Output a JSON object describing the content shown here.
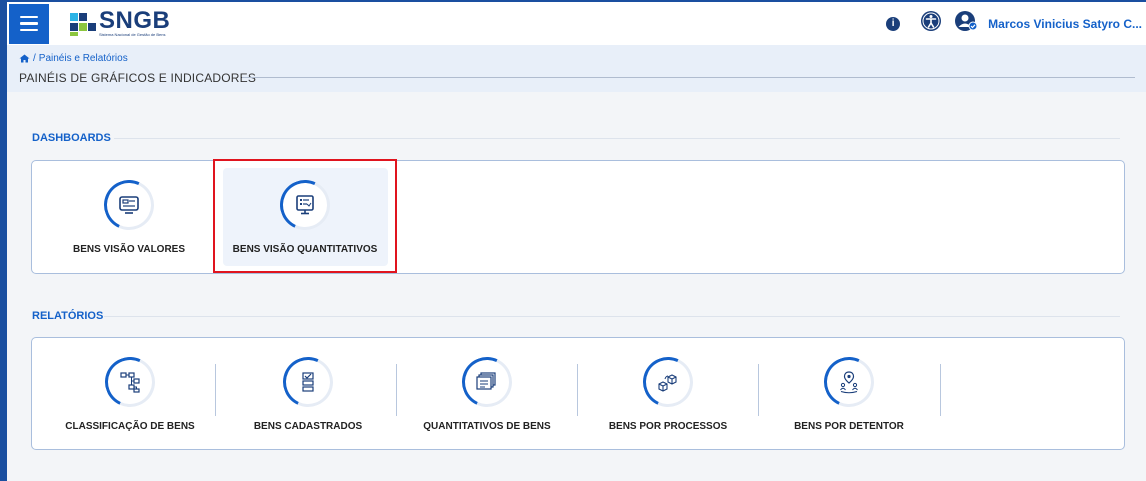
{
  "header": {
    "logo_title": "SNGB",
    "logo_subtitle": "Sistema Nacional de Gestão de Bens",
    "user_name": "Marcos Vinicius Satyro C..."
  },
  "breadcrumb": {
    "home_icon": "home-icon",
    "separator": "/",
    "current": "Painéis e Relatórios"
  },
  "page_title": "PAINÉIS DE GRÁFICOS E INDICADORES",
  "dashboards": {
    "label": "DASHBOARDS",
    "cards": [
      {
        "label": "BENS VISÃO VALORES",
        "icon": "monitor-card-icon"
      },
      {
        "label": "BENS VISÃO QUANTITATIVOS",
        "icon": "monitor-list-icon",
        "selected": true
      }
    ]
  },
  "relatorios": {
    "label": "RELATÓRIOS",
    "cards": [
      {
        "label": "CLASSIFICAÇÃO DE BENS",
        "icon": "hierarchy-icon"
      },
      {
        "label": "BENS CADASTRADOS",
        "icon": "checklist-icon"
      },
      {
        "label": "QUANTITATIVOS DE BENS",
        "icon": "documents-icon"
      },
      {
        "label": "BENS POR PROCESSOS",
        "icon": "boxes-icon"
      },
      {
        "label": "BENS POR DETENTOR",
        "icon": "location-person-icon"
      }
    ]
  },
  "colors": {
    "primary": "#1461c9",
    "navy": "#1a3e7a",
    "highlight": "#e0141e"
  }
}
